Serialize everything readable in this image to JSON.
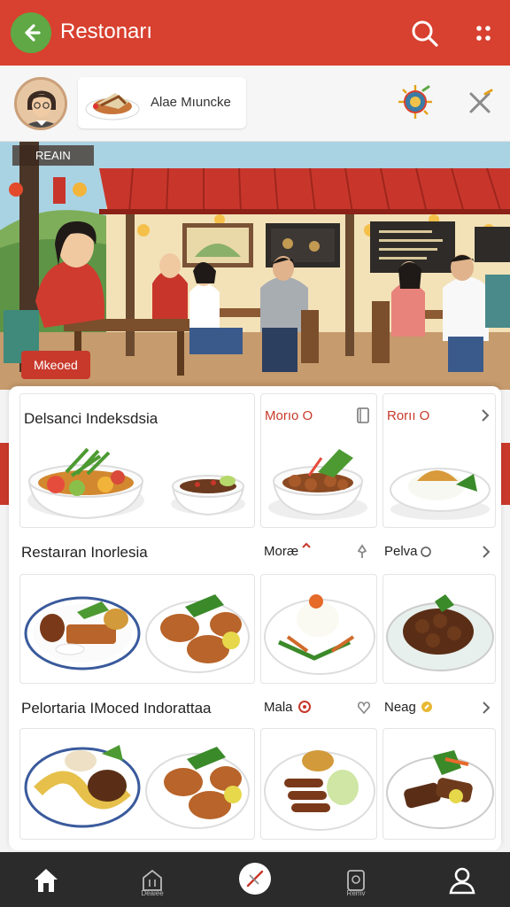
{
  "app_bar": {
    "title": "Restonarı",
    "back_icon": "back-arrow-icon",
    "search_icon": "search-icon",
    "more_icon": "more-dots-icon",
    "color": "#d8402f"
  },
  "profile": {
    "user_name": "Alae Mıuncke",
    "compass_icon": "compass-icon",
    "close_icon": "close-icon"
  },
  "hero": {
    "tag": "RЕΑΙΝ",
    "badge": "Mkeoed"
  },
  "rows": [
    {
      "title": "Delsanci Indeksdsia",
      "items": [
        {
          "label": "Morıo O",
          "icon": "bookmark-icon"
        },
        {
          "label": "Rorıı O",
          "icon": "chevron-right-icon"
        }
      ]
    },
    {
      "title": "Restaıran Inorlesia",
      "items": [
        {
          "label": "Moræ",
          "icon": "pin-icon"
        },
        {
          "label": "Pelva",
          "icon": "chevron-right-icon"
        }
      ]
    },
    {
      "title": "Pelortaria IMoced Indorattaa",
      "items": [
        {
          "label": "Mala",
          "icon": "heart-icon"
        },
        {
          "label": "Neag",
          "icon": "chevron-right-icon"
        }
      ]
    }
  ],
  "nav": {
    "items": [
      {
        "name": "home",
        "icon": "home-icon",
        "label": ""
      },
      {
        "name": "restaurant",
        "icon": "restaurant-icon",
        "label": "Deaiee"
      },
      {
        "name": "center",
        "icon": "utensils-icon",
        "label": ""
      },
      {
        "name": "menu",
        "icon": "menu-book-icon",
        "label": "Remv"
      },
      {
        "name": "profile",
        "icon": "profile-icon",
        "label": ""
      }
    ]
  },
  "colors": {
    "accent": "#d8402f",
    "green": "#5fa845",
    "nav_bg": "#2b2b2b"
  }
}
